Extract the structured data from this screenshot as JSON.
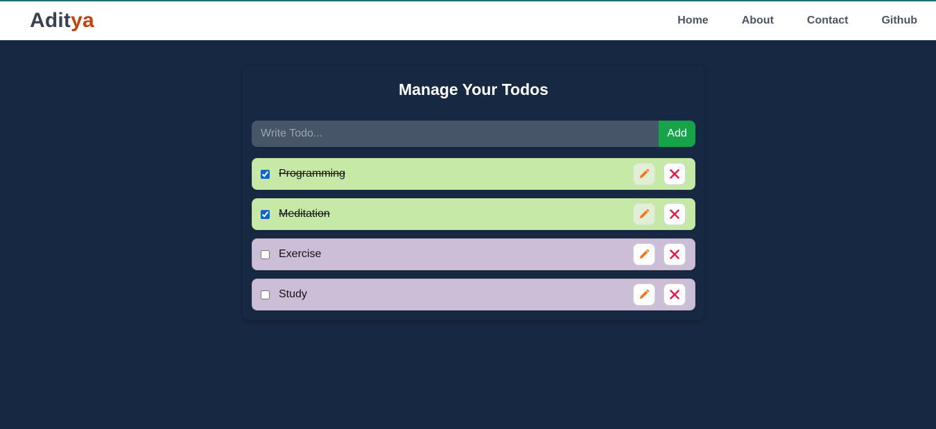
{
  "navbar": {
    "logo_main": "Adit",
    "logo_accent": "ya",
    "links": [
      "Home",
      "About",
      "Contact",
      "Github"
    ]
  },
  "main": {
    "title": "Manage Your Todos",
    "input_placeholder": "Write Todo...",
    "input_value": "",
    "add_label": "Add"
  },
  "todos": [
    {
      "text": "Programming",
      "completed": true
    },
    {
      "text": "Meditation",
      "completed": true
    },
    {
      "text": "Exercise",
      "completed": false
    },
    {
      "text": "Study",
      "completed": false
    }
  ],
  "icons": {
    "edit": "pencil-icon",
    "delete": "close-icon"
  },
  "colors": {
    "background": "#172842",
    "logo_accent": "#c2410c",
    "add_button": "#16a34a",
    "todo_completed": "#c6e9a7",
    "todo_open": "#ccbed7",
    "pencil": "#f97316",
    "close": "#e11d48"
  }
}
